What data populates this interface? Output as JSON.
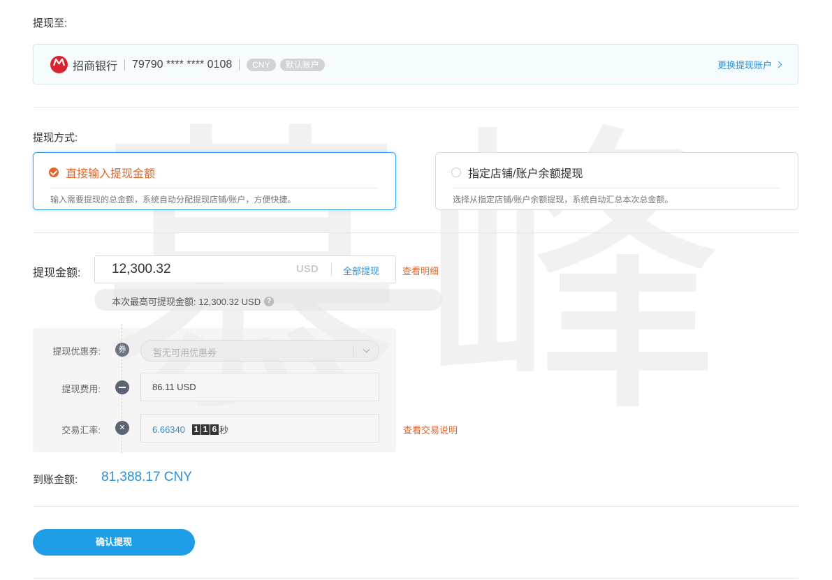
{
  "watermark": "慕峰",
  "withdraw_to": {
    "label": "提现至:",
    "bank_name": "招商银行",
    "account_number": "79790 **** **** 0108",
    "tags": [
      "CNY",
      "默认账户"
    ],
    "change_link": "更换提现账户"
  },
  "method": {
    "label": "提现方式:",
    "options": [
      {
        "title": "直接输入提现金额",
        "desc": "输入需要提现的总金额，系统自动分配提现店铺/账户，方便快捷。",
        "selected": true
      },
      {
        "title": "指定店铺/账户余额提现",
        "desc": "选择从指定店铺/账户余额提现，系统自动汇总本次总金额。",
        "selected": false
      }
    ]
  },
  "amount": {
    "label": "提现金额:",
    "value": "12,300.32",
    "currency": "USD",
    "withdraw_all": "全部提现",
    "detail_link": "查看明细",
    "max_text": "本次最高可提现金额: 12,300.32 USD",
    "help_icon": "question-icon"
  },
  "fees": {
    "coupon": {
      "label": "提现优惠券:",
      "icon_text": "券",
      "placeholder": "暂无可用优惠券"
    },
    "fee": {
      "label": "提现费用:",
      "value": "86.11 USD"
    },
    "rate": {
      "label": "交易汇率:",
      "value": "6.66340",
      "countdown_digits": [
        "1",
        "1",
        "6"
      ],
      "countdown_unit": "秒",
      "link": "查看交易说明"
    }
  },
  "receive": {
    "label": "到账金额:",
    "value": "81,388.17 CNY"
  },
  "confirm_button": "确认提现",
  "colors": {
    "accent_blue": "#1f9ee7",
    "accent_orange": "#e0662b",
    "bank_red": "#d9232e"
  }
}
